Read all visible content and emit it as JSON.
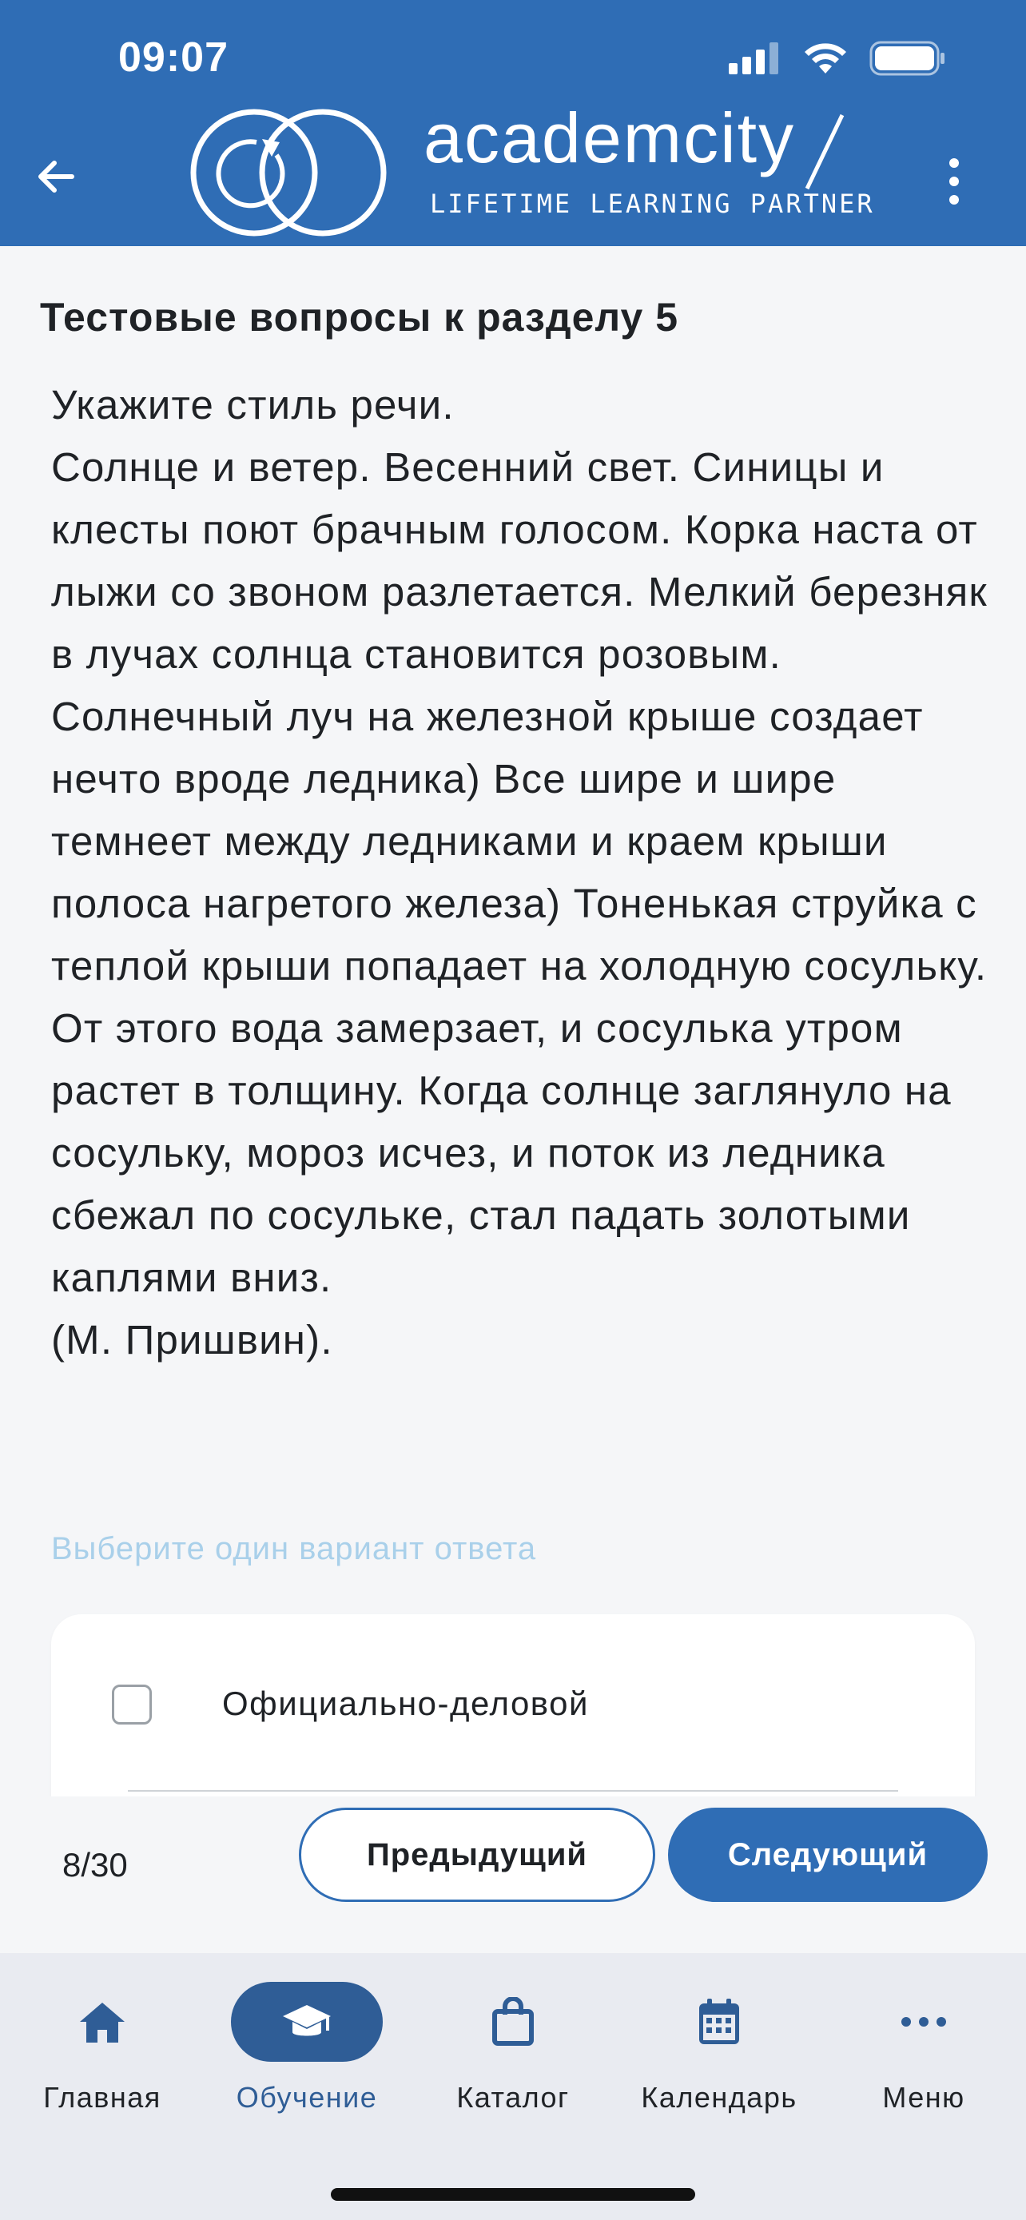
{
  "status_bar": {
    "time": "09:07"
  },
  "header": {
    "brand": "academcity",
    "tagline": "LIFETIME LEARNING PARTNER",
    "accent_color": "#2f6db5",
    "back_icon": "arrow-left-icon",
    "more_icon": "more-vertical-icon"
  },
  "main": {
    "section_title": "Тестовые вопросы к разделу 5",
    "question_lines": [
      "Укажите стиль речи.",
      "Солнце и ветер. Весенний свет. Синицы и клесты поют брачным голосом. Корка наста от лыжи со звоном разлетается. Мелкий березняк в лучах солнца становится розовым. Солнечный луч на железной крыше создает нечто вроде ледника) Все шире и шире темнеет между ледниками и краем крыши полоса нагретого железа) Тоненькая струйка с теплой крыши попадает на холодную сосульку. От этого вода замерзает, и сосулька утром растет в толщину. Когда солнце заглянуло на сосульку, мороз исчез, и поток из ледника сбежал по сосульке, стал падать золотыми каплями вниз.",
      "(М. Пришвин)."
    ],
    "hint": "Выберите один вариант ответа",
    "answers": [
      {
        "label": "Официально-деловой",
        "checked": false
      }
    ]
  },
  "pager": {
    "count": "8/30",
    "prev_label": "Предыдущий",
    "next_label": "Следующий"
  },
  "tabbar": {
    "items": [
      {
        "label": "Главная",
        "icon": "home-icon",
        "active": false
      },
      {
        "label": "Обучение",
        "icon": "graduation-cap-icon",
        "active": true
      },
      {
        "label": "Каталог",
        "icon": "shopping-bag-icon",
        "active": false
      },
      {
        "label": "Календарь",
        "icon": "calendar-icon",
        "active": false
      },
      {
        "label": "Меню",
        "icon": "more-horizontal-icon",
        "active": false
      }
    ]
  }
}
